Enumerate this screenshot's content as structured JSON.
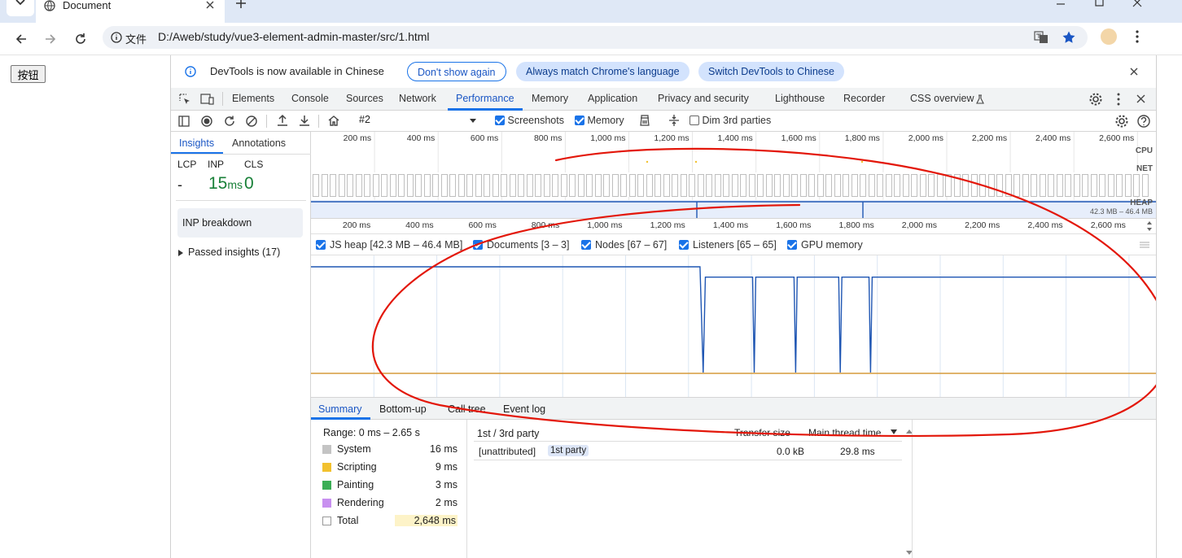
{
  "browser": {
    "tab_title": "Document",
    "url_chip": "文件",
    "url": "D:/Aweb/study/vue3-element-admin-master/src/1.html"
  },
  "page": {
    "button_label": "按钮"
  },
  "infobar": {
    "message": "DevTools is now available in Chinese",
    "dont_show": "Don't show again",
    "always_match": "Always match Chrome's language",
    "switch_chinese": "Switch DevTools to Chinese"
  },
  "devtools_tabs": [
    "Elements",
    "Console",
    "Sources",
    "Network",
    "Performance",
    "Memory",
    "Application",
    "Privacy and security",
    "Lighthouse",
    "Recorder",
    "CSS overview"
  ],
  "active_tab": "Performance",
  "toolbar": {
    "recording": "#2",
    "screenshots": "Screenshots",
    "memory": "Memory",
    "dim_3rd": "Dim 3rd parties"
  },
  "sidebar": {
    "tabs": [
      "Insights",
      "Annotations"
    ],
    "metric_labels": [
      "LCP",
      "INP",
      "CLS"
    ],
    "lcp_value": "-",
    "inp_number": "15",
    "inp_unit": "ms",
    "cls_value": "0",
    "inp_breakdown": "INP breakdown",
    "passed_insights": "Passed insights (17)"
  },
  "overview": {
    "ticks": [
      "200 ms",
      "400 ms",
      "600 ms",
      "800 ms",
      "1,000 ms",
      "1,200 ms",
      "1,400 ms",
      "1,600 ms",
      "1,800 ms",
      "2,000 ms",
      "2,200 ms",
      "2,400 ms",
      "2,600 ms"
    ],
    "cpu_label": "CPU",
    "net_label": "NET",
    "heap_label": "HEAP",
    "heap_range": "42.3 MB – 46.4 MB"
  },
  "timeline": {
    "ticks": [
      "200 ms",
      "400 ms",
      "600 ms",
      "800 ms",
      "1,000 ms",
      "1,200 ms",
      "1,400 ms",
      "1,600 ms",
      "1,800 ms",
      "2,000 ms",
      "2,200 ms",
      "2,400 ms",
      "2,600 ms"
    ]
  },
  "memory_legend": [
    {
      "label": "JS heap [42.3 MB – 46.4 MB]",
      "color": "#7b9ee0"
    },
    {
      "label": "Documents [3 – 3]",
      "color": "#e48080"
    },
    {
      "label": "Nodes [67 – 67]",
      "color": "#7fd97f"
    },
    {
      "label": "Listeners [65 – 65]",
      "color": "#e0b97a"
    },
    {
      "label": "GPU memory",
      "color": "#d97ad9"
    }
  ],
  "chart_data": {
    "type": "line",
    "xlim_ms": [
      0,
      2650
    ],
    "series": [
      {
        "name": "JS heap",
        "color": "#1f56b3",
        "points_ms": [
          [
            0,
            46.4
          ],
          [
            1220,
            46.4
          ],
          [
            1230,
            42.3
          ],
          [
            1237,
            46.0
          ],
          [
            1385,
            46.0
          ],
          [
            1390,
            42.3
          ],
          [
            1395,
            46.0
          ],
          [
            1515,
            46.0
          ],
          [
            1520,
            42.3
          ],
          [
            1525,
            46.0
          ],
          [
            1655,
            46.0
          ],
          [
            1660,
            42.3
          ],
          [
            1665,
            46.0
          ],
          [
            1750,
            46.0
          ],
          [
            1755,
            42.3
          ],
          [
            1760,
            46.0
          ],
          [
            2650,
            46.0
          ]
        ],
        "ylim": [
          42.3,
          46.4
        ]
      },
      {
        "name": "Listeners",
        "color": "#d69a3a",
        "points_ms": [
          [
            0,
            65
          ],
          [
            2650,
            65
          ]
        ]
      }
    ]
  },
  "bottom_tabs": [
    "Summary",
    "Bottom-up",
    "Call tree",
    "Event log"
  ],
  "summary": {
    "range": "Range: 0 ms – 2.65 s",
    "rows": [
      {
        "label": "System",
        "value": "16 ms",
        "color": "#c4c4c4"
      },
      {
        "label": "Scripting",
        "value": "9 ms",
        "color": "#f2c12e"
      },
      {
        "label": "Painting",
        "value": "3 ms",
        "color": "#3aae55"
      },
      {
        "label": "Rendering",
        "value": "2 ms",
        "color": "#c890f0"
      },
      {
        "label": "Total",
        "value": "2,648 ms",
        "color": "#ffffff"
      }
    ],
    "party_header": "1st / 3rd party",
    "transfer_header": "Transfer size",
    "main_thread_header": "Main thread time",
    "row_name": "[unattributed]",
    "row_badge": "1st party",
    "row_transfer": "0.0 kB",
    "row_time": "29.8 ms"
  }
}
